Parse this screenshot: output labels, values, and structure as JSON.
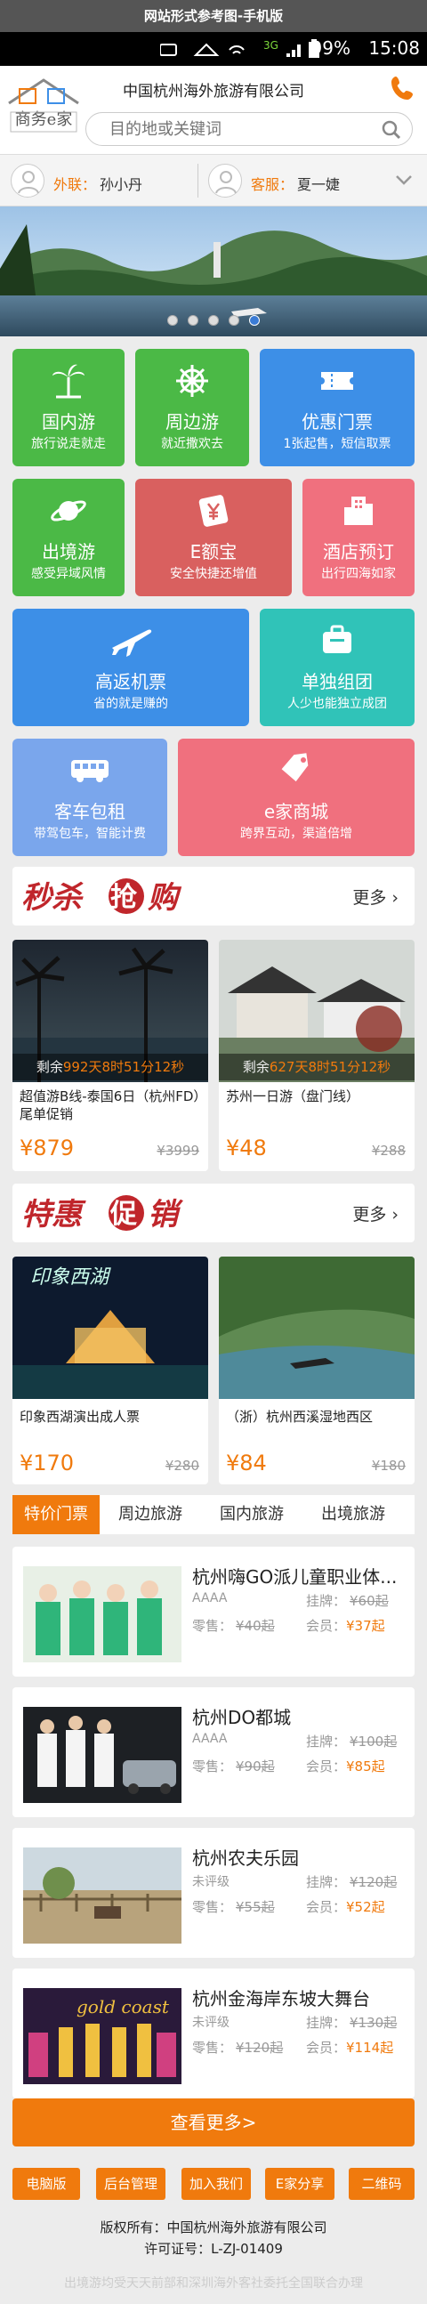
{
  "caption": "网站形式参考图-手机版",
  "status": {
    "signal": "3G",
    "battery": "99%",
    "time": "15:08"
  },
  "header": {
    "logo_text": "商务e家",
    "company": "中国杭州海外旅游有限公司",
    "search_placeholder": "目的地或关键词"
  },
  "contacts": [
    {
      "role": "外联：",
      "name": "孙小丹"
    },
    {
      "role": "客服：",
      "name": "夏一婕"
    }
  ],
  "banner": {
    "slides": 5,
    "active": 4
  },
  "tiles": [
    {
      "title": "国内游",
      "sub": "旅行说走就走",
      "color": "#4bb946",
      "icon": "palm-tree-icon"
    },
    {
      "title": "周边游",
      "sub": "就近撒欢去",
      "color": "#4bb946",
      "icon": "helm-icon"
    },
    {
      "title": "优惠门票",
      "sub": "1张起售，短信取票",
      "color": "#3d8fe7",
      "icon": "ticket-icon"
    },
    {
      "title": "出境游",
      "sub": "感受异域风情",
      "color": "#4bb946",
      "icon": "planet-icon"
    },
    {
      "title": "E额宝",
      "sub": "安全快捷还增值",
      "color": "#d9605f",
      "icon": "yen-icon"
    },
    {
      "title": "酒店预订",
      "sub": "出行四海如家",
      "color": "#f0707e",
      "icon": "hotel-icon"
    },
    {
      "title": "高返机票",
      "sub": "省的就是赚的",
      "color": "#3d8fe7",
      "icon": "plane-icon"
    },
    {
      "title": "单独组团",
      "sub": "人少也能独立成团",
      "color": "#30c3b8",
      "icon": "luggage-icon"
    },
    {
      "title": "客车包租",
      "sub": "带驾包车，智能计费",
      "color": "#7aa6ec",
      "icon": "bus-icon"
    },
    {
      "title": "e家商城",
      "sub": "跨界互动，渠道倍增",
      "color": "#f0707e",
      "icon": "tag-icon"
    }
  ],
  "flash": {
    "heading": "秒杀抢购",
    "more": "更多",
    "items": [
      {
        "countdown_prefix": "剩余",
        "countdown": "992天8时51分12秒",
        "title": "超值游B线-泰国6日（杭州FD）尾单促销",
        "price": "¥879",
        "old": "¥3999"
      },
      {
        "countdown_prefix": "剩余",
        "countdown": "627天8时51分12秒",
        "title": "苏州一日游（盘门线）",
        "price": "¥48",
        "old": "¥288"
      }
    ]
  },
  "special": {
    "heading": "特惠促销",
    "more": "更多",
    "items": [
      {
        "title": "印象西湖演出成人票",
        "price": "¥170",
        "old": "¥280",
        "img_text": "印象西湖"
      },
      {
        "title": "（浙）杭州西溪湿地西区",
        "price": "¥84",
        "old": "¥180"
      }
    ]
  },
  "tabs": [
    "特价门票",
    "周边旅游",
    "国内旅游",
    "出境旅游"
  ],
  "tickets": [
    {
      "name": "杭州嗨GO派儿童职业体...",
      "level": "AAAA",
      "list_label": "挂牌：",
      "list": "¥60起",
      "retail_label": "零售：",
      "retail": "¥40起",
      "member_label": "会员：",
      "member": "¥37起"
    },
    {
      "name": "杭州DO都城",
      "level": "AAAA",
      "list_label": "挂牌：",
      "list": "¥100起",
      "retail_label": "零售：",
      "retail": "¥90起",
      "member_label": "会员：",
      "member": "¥85起"
    },
    {
      "name": "杭州农夫乐园",
      "level": "未评级",
      "list_label": "挂牌：",
      "list": "¥120起",
      "retail_label": "零售：",
      "retail": "¥55起",
      "member_label": "会员：",
      "member": "¥52起"
    },
    {
      "name": "杭州金海岸东坡大舞台",
      "level": "未评级",
      "list_label": "挂牌：",
      "list": "¥130起",
      "retail_label": "零售：",
      "retail": "¥120起",
      "member_label": "会员：",
      "member": "¥114起",
      "img_text": "gold coast"
    }
  ],
  "more_button": "查看更多>",
  "footer": {
    "buttons": [
      "电脑版",
      "后台管理",
      "加入我们",
      "E家分享",
      "二维码"
    ],
    "copyright": "版权所有：中国杭州海外旅游有限公司",
    "license": "许可证号：L-ZJ-01409",
    "note": "出境游均受天天前部和深圳海外客社委托全国联合办理"
  },
  "colors": {
    "accent": "#f07a0d"
  }
}
